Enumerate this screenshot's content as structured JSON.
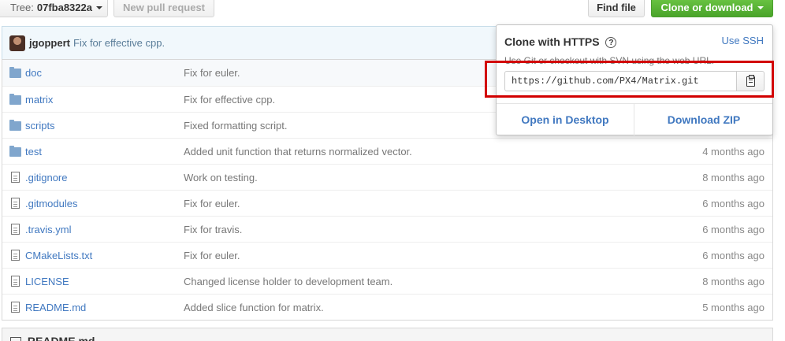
{
  "toolbar": {
    "tree_label": "Tree:",
    "tree_value": "07fba8322a",
    "new_pull_request": "New pull request",
    "find_file": "Find file",
    "clone_or_download": "Clone or download"
  },
  "commit": {
    "author": "jgoppert",
    "message": "Fix for effective cpp."
  },
  "files": [
    {
      "type": "folder",
      "icon": "folder-icon",
      "name": "doc",
      "message": "Fix for euler.",
      "age": ""
    },
    {
      "type": "folder",
      "icon": "folder-icon",
      "name": "matrix",
      "message": "Fix for effective cpp.",
      "age": ""
    },
    {
      "type": "folder",
      "icon": "folder-icon",
      "name": "scripts",
      "message": "Fixed formatting script.",
      "age": ""
    },
    {
      "type": "folder",
      "icon": "folder-icon",
      "name": "test",
      "message": "Added unit function that returns normalized vector.",
      "age": "4 months ago"
    },
    {
      "type": "file",
      "icon": "file-icon",
      "name": ".gitignore",
      "message": "Work on testing.",
      "age": "8 months ago"
    },
    {
      "type": "file",
      "icon": "file-icon",
      "name": ".gitmodules",
      "message": "Fix for euler.",
      "age": "6 months ago"
    },
    {
      "type": "file",
      "icon": "file-icon",
      "name": ".travis.yml",
      "message": "Fix for travis.",
      "age": "6 months ago"
    },
    {
      "type": "file",
      "icon": "file-icon",
      "name": "CMakeLists.txt",
      "message": "Fix for euler.",
      "age": "6 months ago"
    },
    {
      "type": "file",
      "icon": "file-icon",
      "name": "LICENSE",
      "message": "Changed license holder to development team.",
      "age": "8 months ago"
    },
    {
      "type": "file",
      "icon": "file-icon",
      "name": "README.md",
      "message": "Added slice function for matrix.",
      "age": "5 months ago"
    }
  ],
  "readme": {
    "title": "README.md"
  },
  "clone_popover": {
    "title": "Clone with HTTPS",
    "help_icon": "?",
    "use_ssh": "Use SSH",
    "hint": "Use Git or checkout with SVN using the web URL.",
    "url": "https://github.com/PX4/Matrix.git",
    "open_in_desktop": "Open in Desktop",
    "download_zip": "Download ZIP"
  },
  "colors": {
    "accent_link": "#4078c0",
    "clone_button_green": "#6cc644",
    "highlight_red": "#d20000"
  }
}
